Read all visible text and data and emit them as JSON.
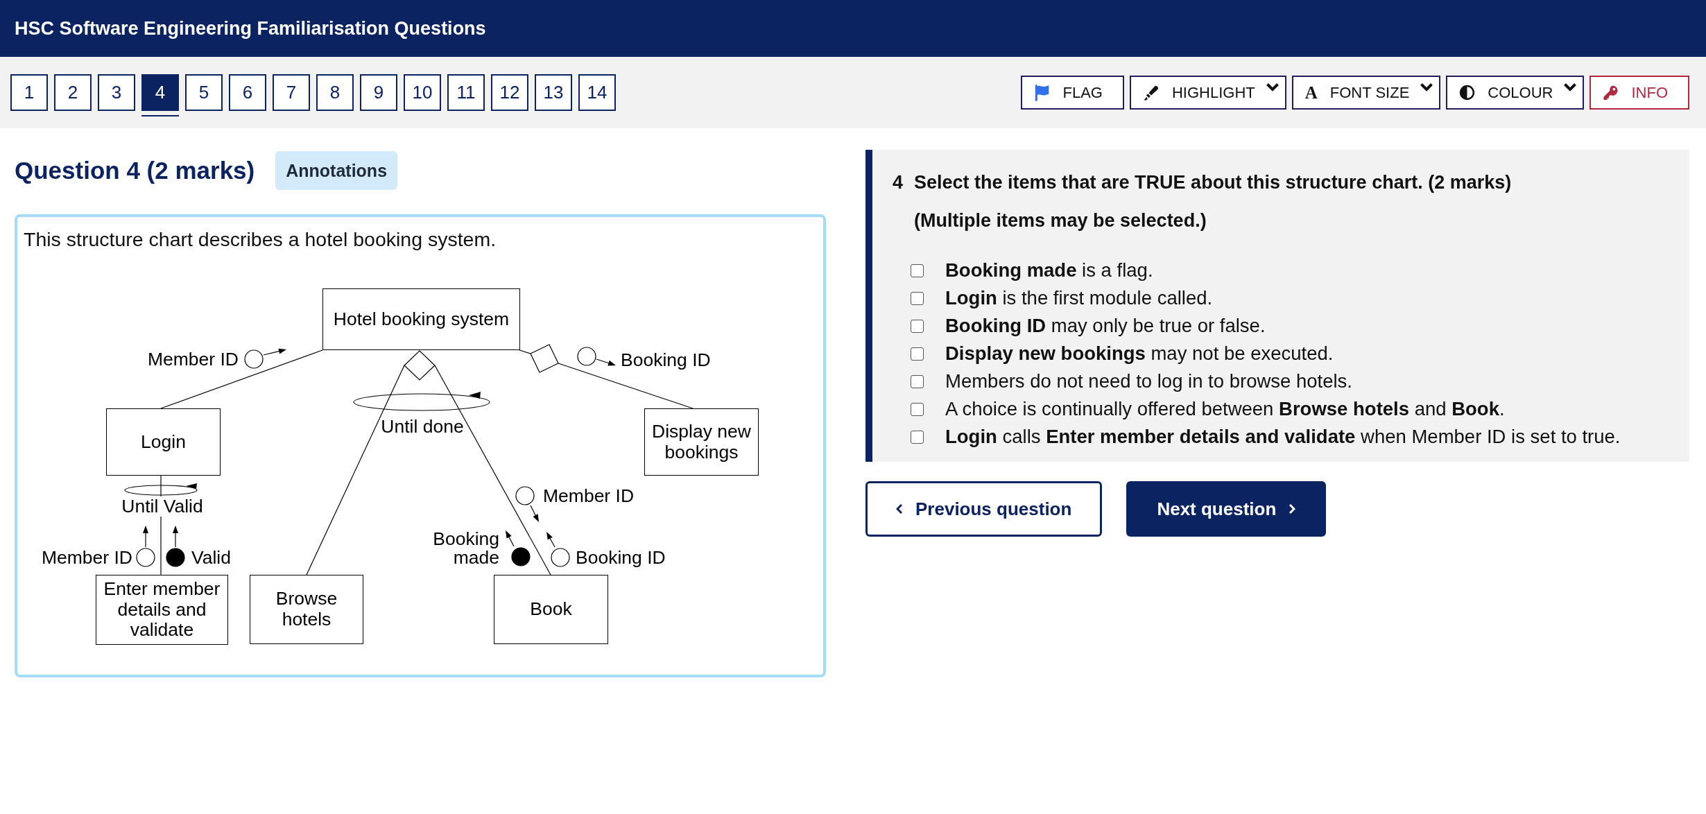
{
  "header": {
    "title": "HSC Software Engineering Familiarisation Questions"
  },
  "question_nav": [
    {
      "label": "1",
      "selected": false
    },
    {
      "label": "2",
      "selected": false
    },
    {
      "label": "3",
      "selected": false
    },
    {
      "label": "4",
      "selected": true
    },
    {
      "label": "5",
      "selected": false
    },
    {
      "label": "6",
      "selected": false
    },
    {
      "label": "7",
      "selected": false
    },
    {
      "label": "8",
      "selected": false
    },
    {
      "label": "9",
      "selected": false
    },
    {
      "label": "10",
      "selected": false
    },
    {
      "label": "11",
      "selected": false
    },
    {
      "label": "12",
      "selected": false
    },
    {
      "label": "13",
      "selected": false
    },
    {
      "label": "14",
      "selected": false
    }
  ],
  "tools": [
    {
      "kind": "flag",
      "label": "FLAG",
      "dropdown": false
    },
    {
      "kind": "highlight",
      "label": "HIGHLIGHT",
      "dropdown": true
    },
    {
      "kind": "font_size",
      "label": "FONT SIZE",
      "dropdown": true,
      "glyph": "A"
    },
    {
      "kind": "colour",
      "label": "COLOUR",
      "dropdown": true
    },
    {
      "kind": "info",
      "label": "INFO",
      "dropdown": false
    }
  ],
  "stimulus": {
    "heading": "Question 4 (2 marks)",
    "annotations_button": "Annotations",
    "intro": "This structure chart describes a hotel booking system.",
    "structure_chart": {
      "modules": [
        {
          "label": "Hotel booking system"
        },
        {
          "label": "Login"
        },
        {
          "label": "Display new bookings"
        },
        {
          "label": "Enter member details and validate"
        },
        {
          "label": "Browse hotels"
        },
        {
          "label": "Book"
        }
      ],
      "couples": [
        {
          "label": "Member ID",
          "kind": "data"
        },
        {
          "label": "Booking ID",
          "kind": "data"
        },
        {
          "label": "Member ID",
          "kind": "data"
        },
        {
          "label": "Valid",
          "kind": "flag"
        },
        {
          "label": "Member ID",
          "kind": "data"
        },
        {
          "label": "Booking made",
          "kind": "flag"
        },
        {
          "label": "Booking ID",
          "kind": "data"
        }
      ],
      "loops": [
        {
          "label": "Until done"
        },
        {
          "label": "Until Valid"
        }
      ]
    }
  },
  "question": {
    "number": "4",
    "prompt": "Select the items that are TRUE about this structure chart. (2 marks)",
    "note": "(Multiple items may be selected.)",
    "options": [
      {
        "text": "**Booking made** is a flag.",
        "checked": false
      },
      {
        "text": "**Login** is the first module called.",
        "checked": false
      },
      {
        "text": "**Booking ID** may only be true or false.",
        "checked": false
      },
      {
        "text": "**Display new bookings** may not be executed.",
        "checked": false
      },
      {
        "text": "Members do not need to log in to browse hotels.",
        "checked": false
      },
      {
        "text": "A choice is continually offered between **Browse hotels** and **Book**.",
        "checked": false
      },
      {
        "text": "**Login** calls **Enter member details and validate** when Member ID is set to true.",
        "checked": false
      }
    ]
  },
  "navigation": [
    {
      "kind": "previous",
      "label": "Previous question"
    },
    {
      "kind": "next",
      "label": "Next question"
    }
  ]
}
